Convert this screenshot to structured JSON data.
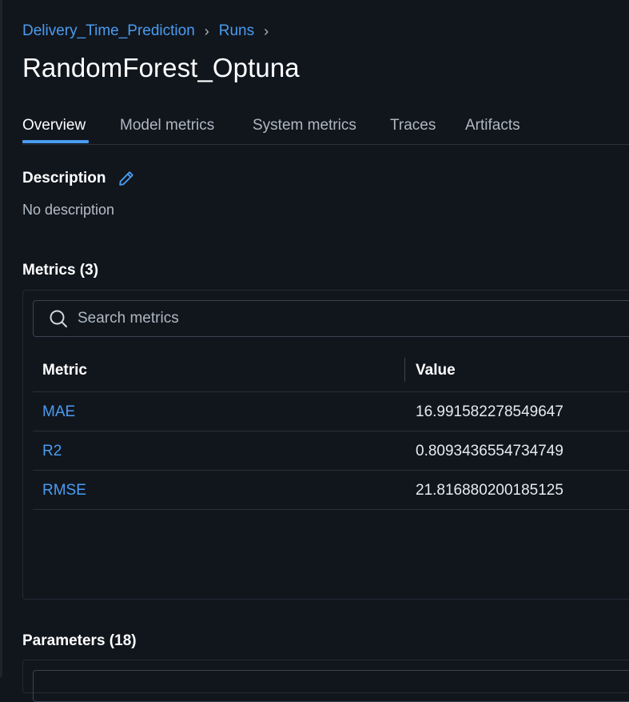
{
  "breadcrumb": {
    "experiment": "Delivery_Time_Prediction",
    "runs": "Runs",
    "separator": "›"
  },
  "page_title": "RandomForest_Optuna",
  "tabs": [
    {
      "label": "Overview",
      "active": true
    },
    {
      "label": "Model metrics",
      "active": false
    },
    {
      "label": "System metrics",
      "active": false
    },
    {
      "label": "Traces",
      "active": false
    },
    {
      "label": "Artifacts",
      "active": false
    }
  ],
  "description": {
    "heading": "Description",
    "edit_icon": "pencil-icon",
    "text": "No description"
  },
  "metrics": {
    "heading": "Metrics (3)",
    "search_placeholder": "Search metrics",
    "search_icon": "search-icon",
    "columns": [
      "Metric",
      "Value"
    ],
    "rows": [
      {
        "metric": "MAE",
        "value": "16.991582278549647"
      },
      {
        "metric": "R2",
        "value": "0.8093436554734749"
      },
      {
        "metric": "RMSE",
        "value": "21.816880200185125"
      }
    ]
  },
  "parameters": {
    "heading": "Parameters (18)"
  },
  "colors": {
    "background": "#11161d",
    "accent": "#4a9cf0",
    "text": "#e6ebf0",
    "muted": "#aeb8c2"
  }
}
